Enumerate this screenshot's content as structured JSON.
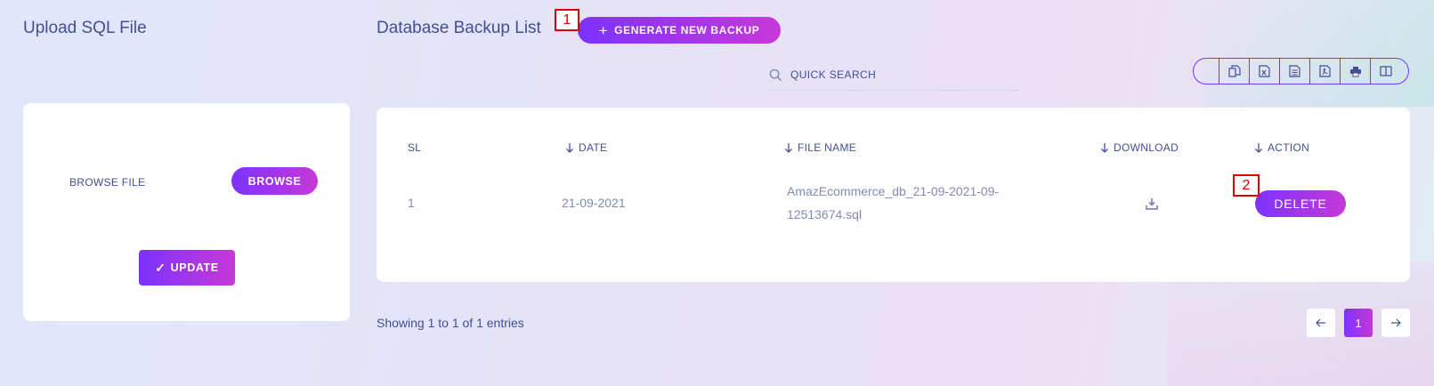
{
  "titles": {
    "upload": "Upload SQL File",
    "backup_list": "Database Backup List"
  },
  "markers": {
    "m1": "1",
    "m2": "2"
  },
  "generate_button": {
    "label": "GENERATE NEW BACKUP",
    "icon": "plus-icon"
  },
  "search": {
    "placeholder": "QUICK SEARCH",
    "value": "",
    "icon": "search-icon"
  },
  "export_buttons": [
    {
      "name": "copy-icon"
    },
    {
      "name": "excel-icon"
    },
    {
      "name": "csv-icon"
    },
    {
      "name": "pdf-icon"
    },
    {
      "name": "print-icon"
    },
    {
      "name": "columns-icon"
    }
  ],
  "upload_form": {
    "browse_label": "BROWSE FILE",
    "browse_button": "BROWSE",
    "update_button": "UPDATE"
  },
  "table": {
    "headers": {
      "sl": "SL",
      "date": "DATE",
      "file_name": "FILE NAME",
      "download": "DOWNLOAD",
      "action": "ACTION"
    },
    "rows": [
      {
        "sl": "1",
        "date": "21-09-2021",
        "file_name_line1": "AmazEcommerce_db_21-09-2021-09-",
        "file_name_line2": "12513674.sql",
        "delete_label": "DELETE"
      }
    ]
  },
  "footer": {
    "entries_text": "Showing 1 to 1 of 1 entries"
  },
  "pagination": {
    "current_page": "1"
  },
  "colors": {
    "accent_start": "#7c32ff",
    "accent_end": "#c738d8",
    "text": "#415094",
    "muted": "#828bb2"
  }
}
